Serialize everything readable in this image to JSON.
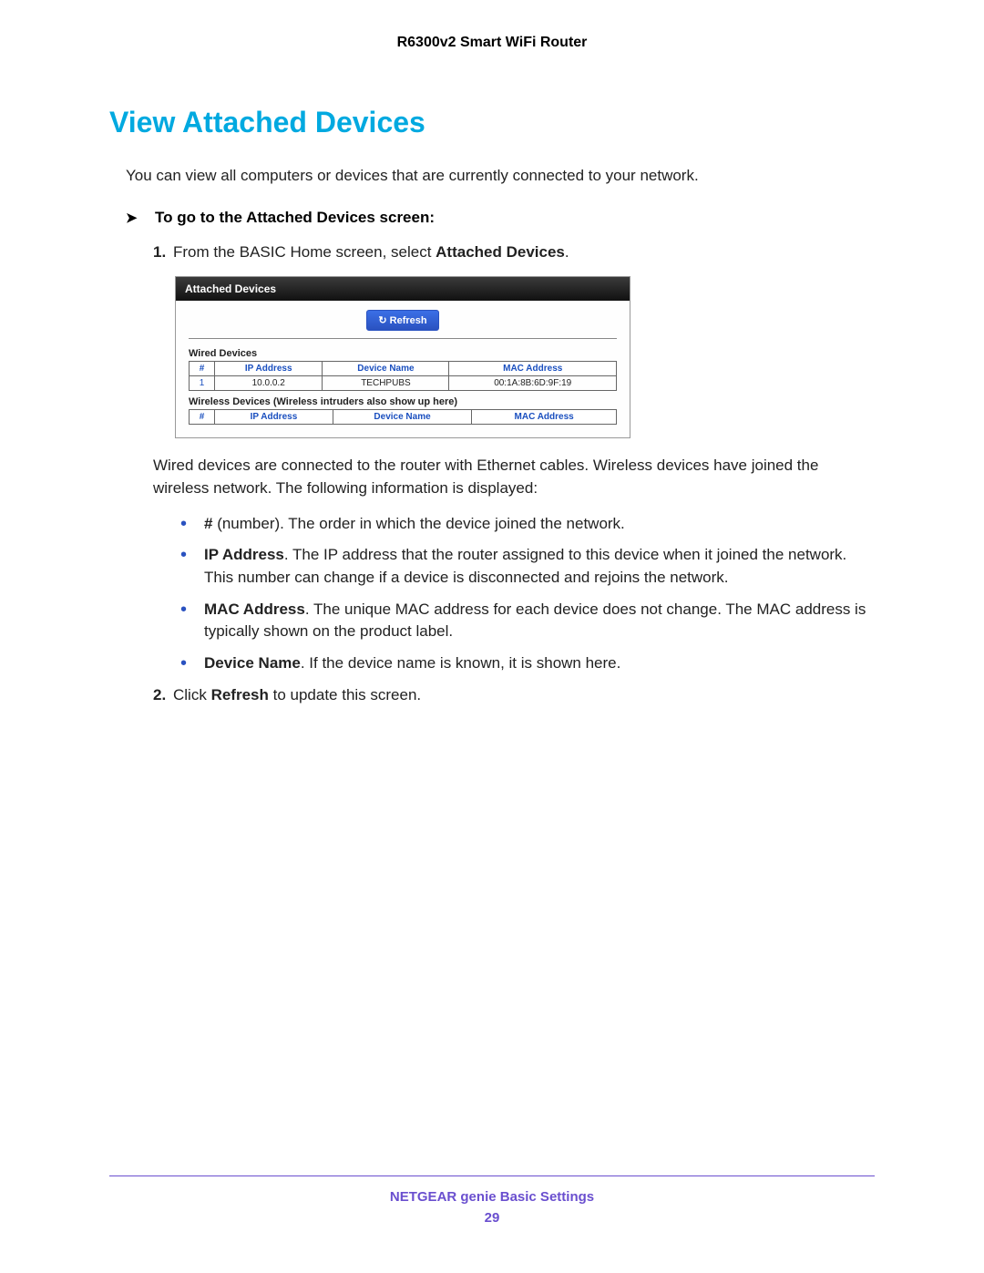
{
  "header": "R6300v2 Smart WiFi Router",
  "section_title": "View Attached Devices",
  "intro": "You can view all computers or devices that are currently connected to your network.",
  "procedure_title": "To go to the Attached Devices screen:",
  "step1_prefix": "From the BASIC Home screen, select ",
  "step1_bold": "Attached Devices",
  "step1_suffix": ".",
  "screenshot": {
    "title": "Attached Devices",
    "refresh": "Refresh",
    "wired_label": "Wired Devices",
    "wireless_label": "Wireless Devices (Wireless intruders also show up here)",
    "cols": {
      "num": "#",
      "ip": "IP Address",
      "name": "Device Name",
      "mac": "MAC Address"
    },
    "wired_rows": [
      {
        "num": "1",
        "ip": "10.0.0.2",
        "name": "TECHPUBS",
        "mac": "00:1A:8B:6D:9F:19"
      }
    ]
  },
  "post_shot": "Wired devices are connected to the router with Ethernet cables. Wireless devices have joined the wireless network. The following information is displayed:",
  "bullets": [
    {
      "bold": "#",
      "rest": " (number). The order in which the device joined the network."
    },
    {
      "bold": "IP Address",
      "rest": ". The IP address that the router assigned to this device when it joined the network. This number can change if a device is disconnected and rejoins the network."
    },
    {
      "bold": "MAC Address",
      "rest": ". The unique MAC address for each device does not change. The MAC address is typically shown on the product label."
    },
    {
      "bold": "Device Name",
      "rest": ". If the device name is known, it is shown here."
    }
  ],
  "step2_prefix": "Click ",
  "step2_bold": "Refresh",
  "step2_suffix": " to update this screen.",
  "footer_title": "NETGEAR genie Basic Settings",
  "footer_page": "29"
}
